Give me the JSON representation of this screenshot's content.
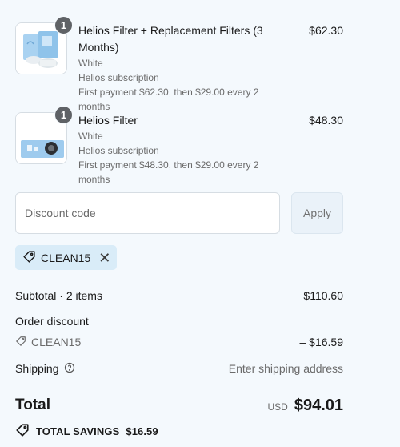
{
  "items": [
    {
      "quantity": "1",
      "name": "Helios Filter + Replacement Filters (3 Months)",
      "variant": "White",
      "plan": "Helios subscription",
      "payment": "First payment $62.30, then $29.00 every 2 months",
      "price": "$62.30"
    },
    {
      "quantity": "1",
      "name": "Helios Filter",
      "variant": "White",
      "plan": "Helios subscription",
      "payment": "First payment $48.30, then $29.00 every 2 months",
      "price": "$48.30"
    }
  ],
  "discount": {
    "placeholder": "Discount code",
    "apply_label": "Apply",
    "applied_code": "CLEAN15"
  },
  "summary": {
    "subtotal_label": "Subtotal · 2 items",
    "subtotal_value": "$110.60",
    "order_discount_label": "Order discount",
    "discount_code": "CLEAN15",
    "discount_value": "– $16.59",
    "shipping_label": "Shipping",
    "shipping_value": "Enter shipping address",
    "total_label": "Total",
    "currency": "USD",
    "total_value": "$94.01",
    "savings_label": "TOTAL SAVINGS",
    "savings_value": "$16.59"
  },
  "colors": {
    "background": "#f4f9fd",
    "chip": "#d9ecf8",
    "product_blue": "#9ecbee"
  }
}
